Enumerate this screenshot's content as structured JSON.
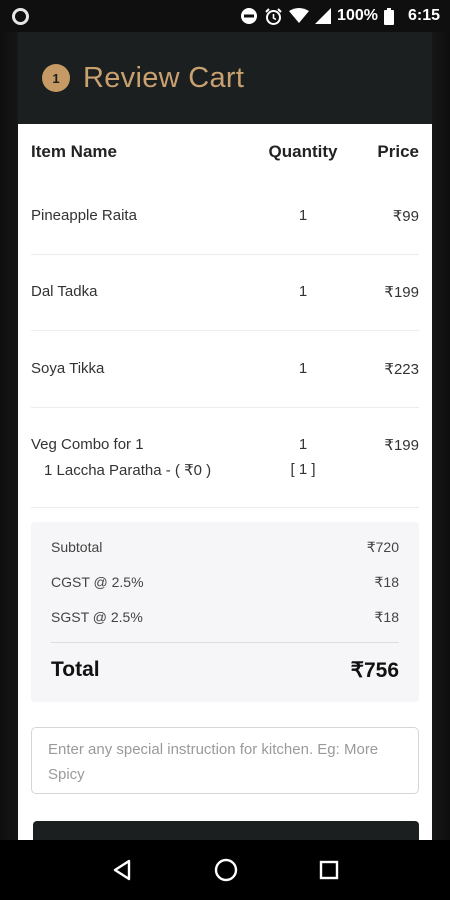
{
  "status_bar": {
    "battery": "100%",
    "time": "6:15"
  },
  "header": {
    "step_number": "1",
    "title": "Review Cart"
  },
  "table": {
    "headers": {
      "name": "Item Name",
      "quantity": "Quantity",
      "price": "Price"
    },
    "items": [
      {
        "name": "Pineapple Raita",
        "quantity": "1",
        "price": "₹99"
      },
      {
        "name": "Dal Tadka",
        "quantity": "1",
        "price": "₹199"
      },
      {
        "name": "Soya Tikka",
        "quantity": "1",
        "price": "₹223"
      },
      {
        "name": "Veg Combo for 1",
        "quantity": "1",
        "price": "₹199",
        "sub_item": "1 Laccha Paratha - ( ₹0 )",
        "sub_quantity": "[ 1 ]"
      }
    ]
  },
  "summary": {
    "subtotal_label": "Subtotal",
    "subtotal_value": "₹720",
    "cgst_label": "CGST @ 2.5%",
    "cgst_value": "₹18",
    "sgst_label": "SGST @ 2.5%",
    "sgst_value": "₹18",
    "total_label": "Total",
    "total_value": "₹756"
  },
  "instruction": {
    "placeholder": "Enter any special instruction for kitchen. Eg: More Spicy"
  },
  "icons": {
    "status": [
      "notification-dot-icon",
      "do-not-disturb-icon",
      "alarm-icon",
      "wifi-icon",
      "signal-icon",
      "battery-icon"
    ],
    "nav": [
      "back-icon",
      "home-icon",
      "recents-icon"
    ]
  },
  "colors": {
    "accent": "#c9a070",
    "header_bg": "#1b1f1f",
    "summary_bg": "#f6f5f7"
  }
}
